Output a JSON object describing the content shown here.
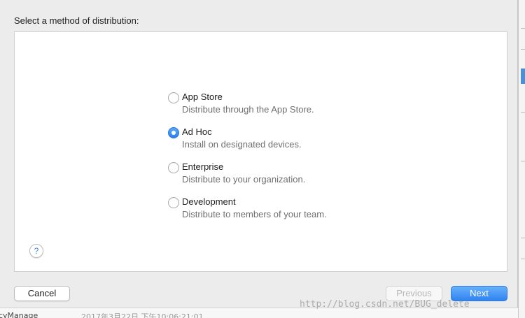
{
  "dialog": {
    "prompt": "Select a method of distribution:",
    "options": [
      {
        "title": "App Store",
        "description": "Distribute through the App Store.",
        "selected": false
      },
      {
        "title": "Ad Hoc",
        "description": "Install on designated devices.",
        "selected": true
      },
      {
        "title": "Enterprise",
        "description": "Distribute to your organization.",
        "selected": false
      },
      {
        "title": "Development",
        "description": "Distribute to members of your team.",
        "selected": false
      }
    ],
    "help_label": "?",
    "buttons": {
      "cancel": "Cancel",
      "previous": "Previous",
      "next": "Next"
    }
  },
  "background": {
    "bottom_left_text": "cyManage",
    "bottom_date_text": "2017年3月22日 下午10:06:21:01"
  },
  "watermark": "http://blog.csdn.net/BUG_delete",
  "colors": {
    "accent": "#2f83f0",
    "panel": "#ffffff",
    "window": "#ececec"
  }
}
